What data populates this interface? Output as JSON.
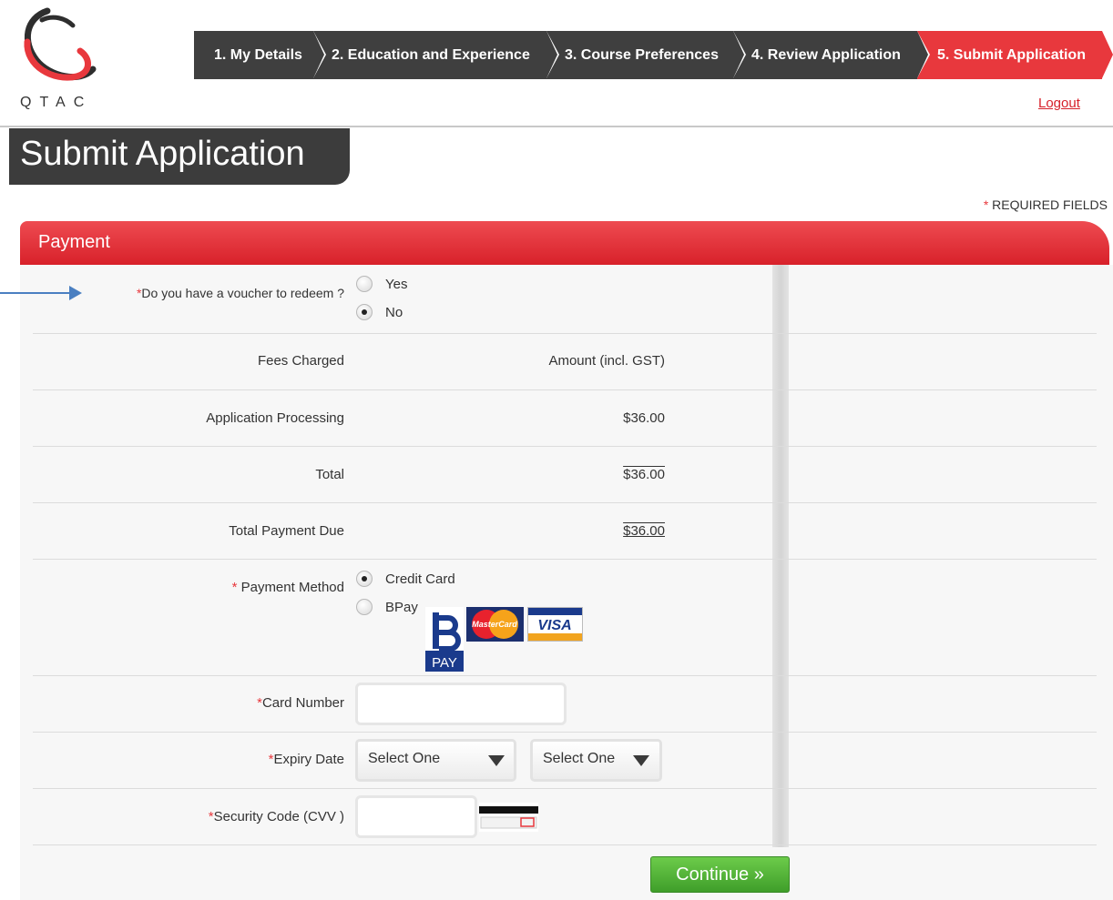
{
  "logo": {
    "text": "QTAC"
  },
  "steps": [
    "1. My Details",
    "2. Education and Experience",
    "3. Course Preferences",
    "4. Review Application",
    "5. Submit Application"
  ],
  "logout": "Logout",
  "page_title": "Submit Application",
  "required_note": {
    "star": "*",
    "text": " REQUIRED FIELDS"
  },
  "section_title": "Payment",
  "voucher": {
    "label": "Do you have a voucher to redeem ?",
    "options": [
      "Yes",
      "No"
    ],
    "selected": "No"
  },
  "fees": {
    "header_label": "Fees Charged",
    "header_amount": "Amount (incl. GST)",
    "rows": [
      {
        "label": "Application Processing",
        "amount": "$36.00"
      },
      {
        "label": "Total",
        "amount": "$36.00"
      },
      {
        "label": "Total Payment Due",
        "amount": "$36.00"
      }
    ]
  },
  "payment_method": {
    "label": "Payment Method",
    "options": [
      "Credit Card",
      "BPay"
    ],
    "selected": "Credit Card",
    "logos": {
      "bpay_text": "PAY",
      "mastercard_text": "MasterCard",
      "visa_text": "VISA"
    }
  },
  "card_number": {
    "label": "Card Number",
    "value": ""
  },
  "expiry": {
    "label": "Expiry Date",
    "month": "Select One",
    "year": "Select One"
  },
  "cvv": {
    "label": "Security Code (CVV )",
    "value": ""
  },
  "continue_label": "Continue »",
  "colors": {
    "accent": "#e8383d",
    "dark": "#3f3f3f",
    "button": "#4caf35",
    "link": "#d6202a"
  }
}
